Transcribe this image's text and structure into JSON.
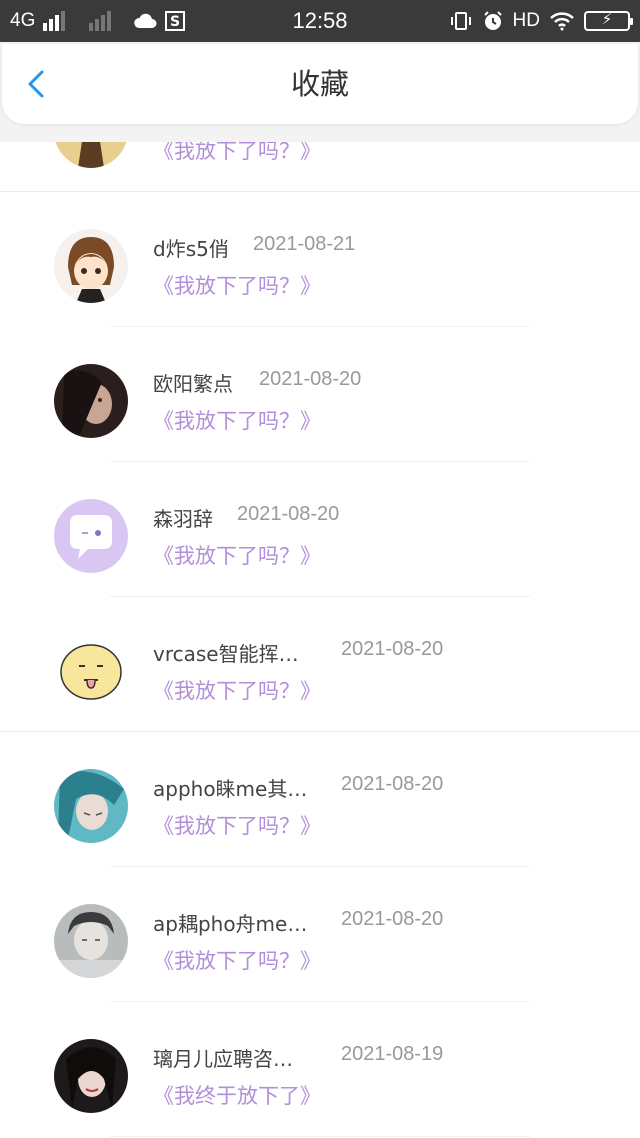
{
  "status_bar": {
    "carrier": "4G",
    "time": "12:58",
    "hd": "HD",
    "icons": [
      "signal-icon",
      "signal-icon",
      "cloud-icon",
      "s-app-icon",
      "vibrate-icon",
      "alarm-icon",
      "wifi-icon",
      "battery-icon"
    ]
  },
  "header": {
    "title": "收藏",
    "back_icon": "chevron-left-icon",
    "accent_color": "#2196f3"
  },
  "colors": {
    "snippet": "#b28fd9",
    "name": "#444444",
    "date": "#999999"
  },
  "list": {
    "items": [
      {
        "name": "",
        "date": "",
        "snippet": "《我放下了吗？》"
      },
      {
        "name": "d炸s5俏",
        "date": "2021-08-21",
        "snippet": "《我放下了吗？》"
      },
      {
        "name": "欧阳繁点",
        "date": "2021-08-20",
        "snippet": "《我放下了吗？》"
      },
      {
        "name": "森羽辞",
        "date": "2021-08-20",
        "snippet": "《我放下了吗？》"
      },
      {
        "name": "vrcase智能挥…",
        "date": "2021-08-20",
        "snippet": "《我放下了吗？》"
      },
      {
        "name": "appho睐me其…",
        "date": "2021-08-20",
        "snippet": "《我放下了吗？》"
      },
      {
        "name": "ap耦pho舟me…",
        "date": "2021-08-20",
        "snippet": "《我放下了吗？》"
      },
      {
        "name": "璃月儿应聘咨…",
        "date": "2021-08-19",
        "snippet": "《我终于放下了》"
      }
    ]
  }
}
